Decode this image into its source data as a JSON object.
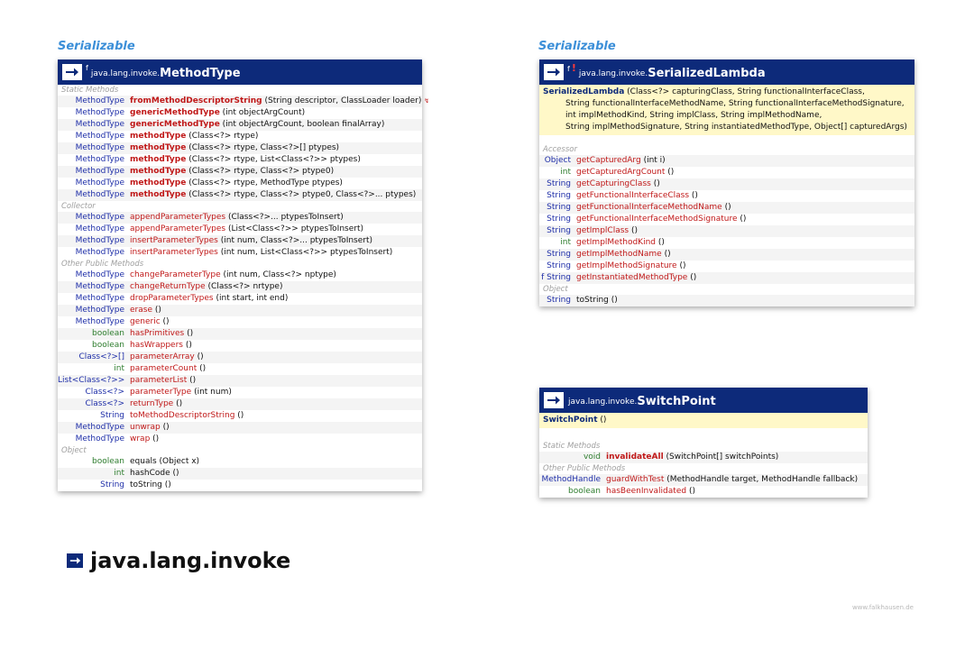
{
  "sections": {
    "left": "Serializable",
    "right": "Serializable"
  },
  "methodtype": {
    "mods": "f",
    "package": "java.lang.invoke.",
    "name": "MethodType",
    "groups": [
      {
        "label": "Static Methods",
        "rows": [
          {
            "rt": "MethodType",
            "name": "fromMethodDescriptorString",
            "bold": true,
            "args": "(String descriptor, ClassLoader loader) ",
            "extra": "↯"
          },
          {
            "rt": "MethodType",
            "name": "genericMethodType",
            "bold": true,
            "args": "(int objectArgCount)"
          },
          {
            "rt": "MethodType",
            "name": "genericMethodType",
            "bold": true,
            "args": "(int objectArgCount, boolean finalArray)"
          },
          {
            "rt": "MethodType",
            "name": "methodType",
            "bold": true,
            "args": "(Class<?> rtype)"
          },
          {
            "rt": "MethodType",
            "name": "methodType",
            "bold": true,
            "args": "(Class<?> rtype, Class<?>[] ptypes)"
          },
          {
            "rt": "MethodType",
            "name": "methodType",
            "bold": true,
            "args": "(Class<?> rtype, List<Class<?>> ptypes)"
          },
          {
            "rt": "MethodType",
            "name": "methodType",
            "bold": true,
            "args": "(Class<?> rtype, Class<?> ptype0)"
          },
          {
            "rt": "MethodType",
            "name": "methodType",
            "bold": true,
            "args": "(Class<?> rtype, MethodType ptypes)"
          },
          {
            "rt": "MethodType",
            "name": "methodType",
            "bold": true,
            "args": "(Class<?> rtype, Class<?> ptype0, Class<?>... ptypes)"
          }
        ]
      },
      {
        "label": "Collector",
        "rows": [
          {
            "rt": "MethodType",
            "name": "appendParameterTypes",
            "args": "(Class<?>... ptypesToInsert)"
          },
          {
            "rt": "MethodType",
            "name": "appendParameterTypes",
            "args": "(List<Class<?>> ptypesToInsert)"
          },
          {
            "rt": "MethodType",
            "name": "insertParameterTypes",
            "args": "(int num, Class<?>... ptypesToInsert)"
          },
          {
            "rt": "MethodType",
            "name": "insertParameterTypes",
            "args": "(int num, List<Class<?>> ptypesToInsert)"
          }
        ]
      },
      {
        "label": "Other Public Methods",
        "rows": [
          {
            "rt": "MethodType",
            "name": "changeParameterType",
            "args": "(int num, Class<?> nptype)"
          },
          {
            "rt": "MethodType",
            "name": "changeReturnType",
            "args": "(Class<?> nrtype)"
          },
          {
            "rt": "MethodType",
            "name": "dropParameterTypes",
            "args": "(int start, int end)"
          },
          {
            "rt": "MethodType",
            "name": "erase",
            "args": "()"
          },
          {
            "rt": "MethodType",
            "name": "generic",
            "args": "()"
          },
          {
            "rt": "boolean",
            "prim": true,
            "name": "hasPrimitives",
            "args": "()"
          },
          {
            "rt": "boolean",
            "prim": true,
            "name": "hasWrappers",
            "args": "()"
          },
          {
            "rt": "Class<?>[]",
            "name": "parameterArray",
            "args": "()"
          },
          {
            "rt": "int",
            "prim": true,
            "name": "parameterCount",
            "args": "()"
          },
          {
            "rt": "List<Class<?>>",
            "name": "parameterList",
            "args": "()"
          },
          {
            "rt": "Class<?>",
            "name": "parameterType",
            "args": "(int num)"
          },
          {
            "rt": "Class<?>",
            "name": "returnType",
            "args": "()"
          },
          {
            "rt": "String",
            "name": "toMethodDescriptorString",
            "args": "()"
          },
          {
            "rt": "MethodType",
            "name": "unwrap",
            "args": "()"
          },
          {
            "rt": "MethodType",
            "name": "wrap",
            "args": "()"
          }
        ]
      },
      {
        "label": "Object",
        "rows": [
          {
            "rt": "boolean",
            "prim": true,
            "name": "equals",
            "plain": true,
            "args": "(Object x)"
          },
          {
            "rt": "int",
            "prim": true,
            "name": "hashCode",
            "plain": true,
            "args": "()"
          },
          {
            "rt": "String",
            "name": "toString",
            "plain": true,
            "args": "()"
          }
        ]
      }
    ]
  },
  "serializedlambda": {
    "mods": "f",
    "excl": "!",
    "package": "java.lang.invoke.",
    "name": "SerializedLambda",
    "ctor": {
      "name": "SerializedLambda",
      "lines": [
        "(Class<?> capturingClass, String functionalInterfaceClass,",
        "String functionalInterfaceMethodName, String functionalInterfaceMethodSignature,",
        "int implMethodKind, String implClass, String implMethodName,",
        "String implMethodSignature, String instantiatedMethodType, Object[] capturedArgs)"
      ]
    },
    "groups": [
      {
        "label": "Accessor",
        "rows": [
          {
            "rt": "Object",
            "name": "getCapturedArg",
            "args": "(int i)"
          },
          {
            "rt": "int",
            "prim": true,
            "name": "getCapturedArgCount",
            "args": "()"
          },
          {
            "rt": "String",
            "name": "getCapturingClass",
            "args": "()"
          },
          {
            "rt": "String",
            "name": "getFunctionalInterfaceClass",
            "args": "()"
          },
          {
            "rt": "String",
            "name": "getFunctionalInterfaceMethodName",
            "args": "()"
          },
          {
            "rt": "String",
            "name": "getFunctionalInterfaceMethodSignature",
            "args": "()"
          },
          {
            "rt": "String",
            "name": "getImplClass",
            "args": "()"
          },
          {
            "rt": "int",
            "prim": true,
            "name": "getImplMethodKind",
            "args": "()"
          },
          {
            "rt": "String",
            "name": "getImplMethodName",
            "args": "()"
          },
          {
            "rt": "String",
            "name": "getImplMethodSignature",
            "args": "()"
          },
          {
            "rt": "f String",
            "name": "getInstantiatedMethodType",
            "args": "()"
          }
        ]
      },
      {
        "label": "Object",
        "rows": [
          {
            "rt": "String",
            "name": "toString",
            "plain": true,
            "args": "()"
          }
        ]
      }
    ]
  },
  "switchpoint": {
    "package": "java.lang.invoke.",
    "name": "SwitchPoint",
    "ctor": {
      "name": "SwitchPoint",
      "lines": [
        "()"
      ]
    },
    "groups": [
      {
        "label": "Static Methods",
        "rows": [
          {
            "rt": "void",
            "prim": true,
            "name": "invalidateAll",
            "bold": true,
            "args": "(SwitchPoint[] switchPoints)"
          }
        ]
      },
      {
        "label": "Other Public Methods",
        "rows": [
          {
            "rt": "MethodHandle",
            "name": "guardWithTest",
            "args": "(MethodHandle target, MethodHandle fallback)"
          },
          {
            "rt": "boolean",
            "prim": true,
            "name": "hasBeenInvalidated",
            "args": "()"
          }
        ]
      }
    ]
  },
  "package_title": "java.lang.invoke",
  "footer": "www.falkhausen.de",
  "colors": {
    "header": "#0d2a7a",
    "section": "#3c8fd8",
    "method": "#c01818",
    "type": "#1e2ea8",
    "primitive": "#2e7d2e",
    "ctor_bg": "#fff8c8"
  }
}
